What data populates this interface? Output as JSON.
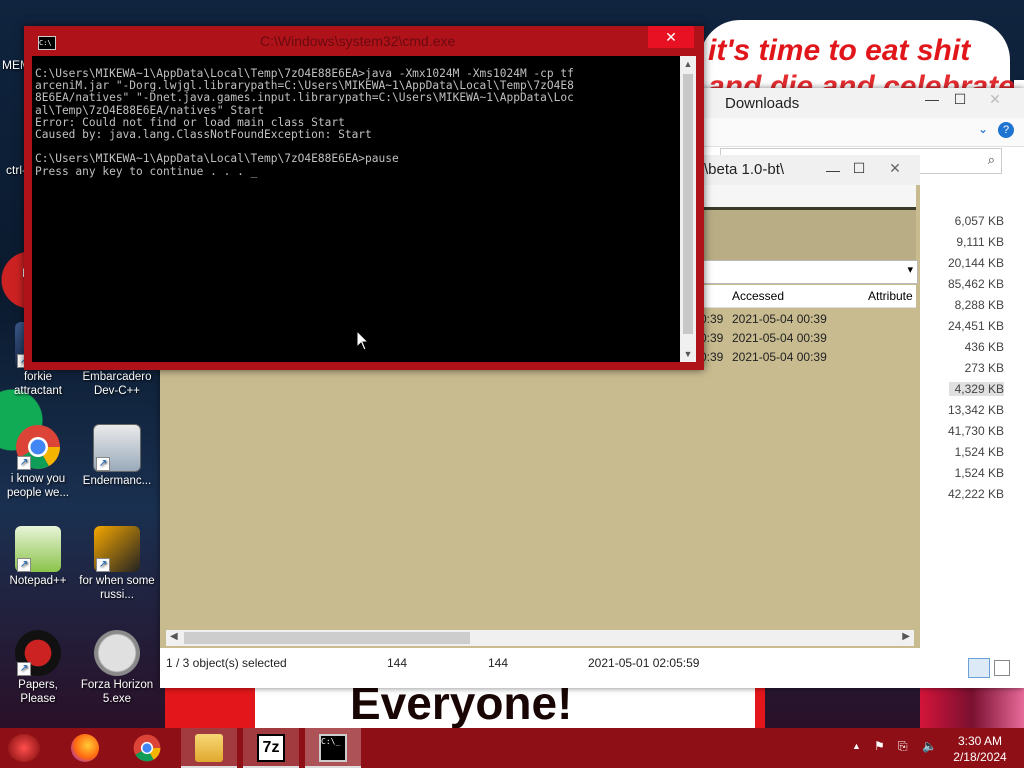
{
  "desktop": {
    "banner_line1": "it's time to eat shit",
    "banner_line2": "and die and celebrate",
    "bottom_banner": "Everyone!",
    "top_left_partial": "MEM",
    "ctrl_partial": "ctrl-",
    "f_partial": "F",
    "icons": [
      {
        "label": "forkie attractant"
      },
      {
        "label": "Embarcadero Dev-C++"
      },
      {
        "label": "i know you people we..."
      },
      {
        "label": "Endermanc..."
      },
      {
        "label": "Notepad++"
      },
      {
        "label": "for when some russi..."
      },
      {
        "label": "Papers, Please"
      },
      {
        "label": "Forza Horizon 5.exe"
      }
    ]
  },
  "console": {
    "title": "C:\\Windows\\system32\\cmd.exe",
    "output": "C:\\Users\\MIKEWA~1\\AppData\\Local\\Temp\\7zO4E88E6EA>java -Xmx1024M -Xms1024M -cp tf\narceniM.jar \"-Dorg.lwjgl.librarypath=C:\\Users\\MIKEWA~1\\AppData\\Local\\Temp\\7zO4E8\n8E6EA/natives\" \"-Dnet.java.games.input.librarypath=C:\\Users\\MIKEWA~1\\AppData\\Loc\nal\\Temp\\7zO4E88E6EA/natives\" Start\nError: Could not find or load main class Start\nCaused by: java.lang.ClassNotFoundException: Start\n\nC:\\Users\\MIKEWA~1\\AppData\\Local\\Temp\\7zO4E88E6EA>pause\nPress any key to continue . . . _",
    "close_glyph": "✕"
  },
  "explorer": {
    "title": "Downloads",
    "sizes": [
      "6,057 KB",
      "9,111 KB",
      "20,144 KB",
      "85,462 KB",
      "8,288 KB",
      "24,451 KB",
      "436 KB",
      "273 KB",
      "4,329 KB",
      "13,342 KB",
      "41,730 KB",
      "1,524 KB",
      "1,524 KB",
      "42,222 KB"
    ],
    "size_col_partial": "e",
    "status": {
      "selected": "1 / 3 object(s) selected",
      "size1": "144",
      "size2": "144",
      "modified": "2021-05-01 02:05:59"
    }
  },
  "archive": {
    "path": "\\beta 1.0-bt\\",
    "col_accessed": "Accessed",
    "col_attributes": "Attribute",
    "rows": [
      {
        "time_partial": "0:39",
        "accessed": "2021-05-04 00:39"
      },
      {
        "time_partial": "0:39",
        "accessed": "2021-05-04 00:39"
      },
      {
        "time_partial": "0:39",
        "accessed": "2021-05-04 00:39"
      }
    ]
  },
  "taskbar": {
    "apps": [
      "firefox-icon",
      "chrome-icon",
      "file-explorer-icon",
      "7zip-icon",
      "cmd-icon"
    ],
    "sevenzip_label": "7z",
    "clock_time": "3:30 AM",
    "clock_date": "2/18/2024"
  }
}
